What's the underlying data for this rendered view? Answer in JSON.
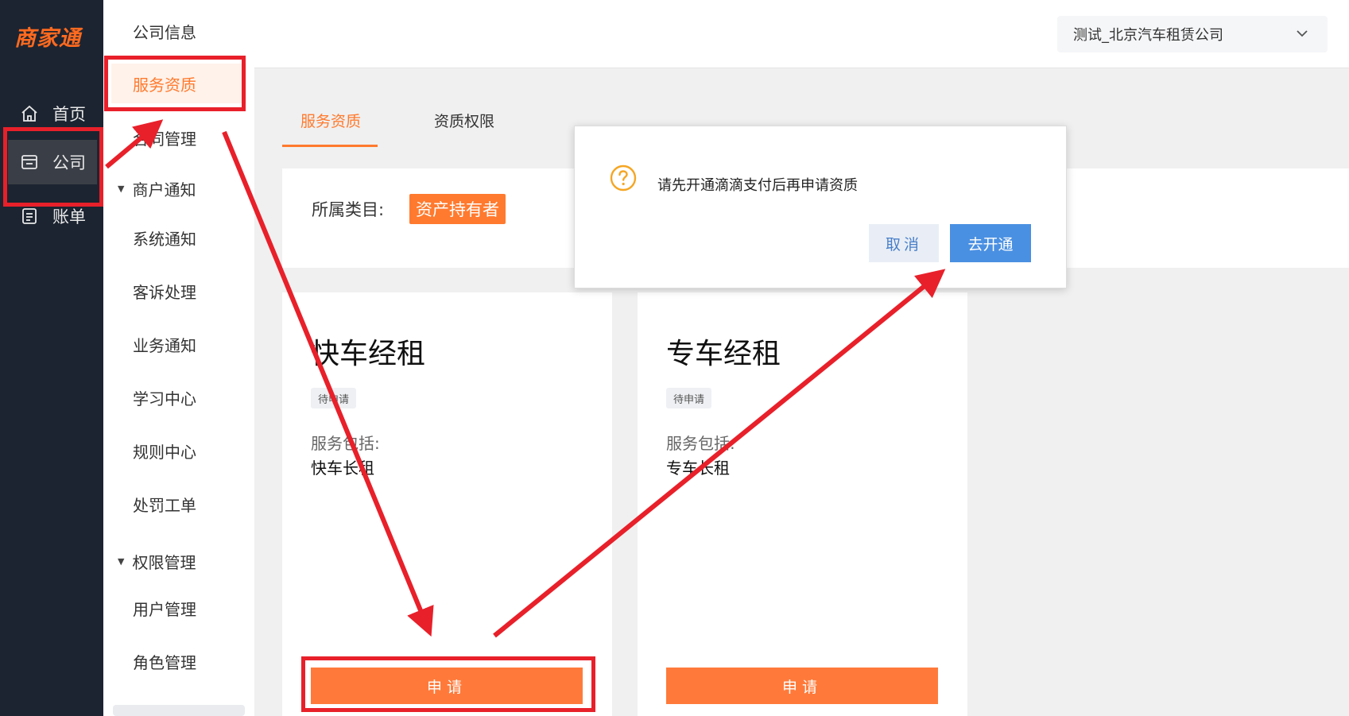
{
  "app": {
    "logo": "商家通"
  },
  "rail": {
    "items": [
      {
        "label": "首页",
        "icon": "home-icon"
      },
      {
        "label": "公司",
        "icon": "store-icon",
        "active": true
      },
      {
        "label": "账单",
        "icon": "bill-icon"
      }
    ]
  },
  "submenu": {
    "items": [
      {
        "label": "公司信息"
      },
      {
        "label": "服务资质",
        "active": true
      },
      {
        "label": "合同管理"
      }
    ],
    "groups": [
      {
        "label": "商户通知",
        "items": [
          "系统通知",
          "客诉处理",
          "业务通知",
          "学习中心",
          "规则中心",
          "处罚工单"
        ]
      },
      {
        "label": "权限管理",
        "items": [
          "用户管理",
          "角色管理"
        ]
      }
    ]
  },
  "header": {
    "company": "测试_北京汽车租赁公司"
  },
  "tabs": [
    {
      "label": "服务资质",
      "active": true
    },
    {
      "label": "资质权限"
    }
  ],
  "category": {
    "label": "所属类目:",
    "value": "资产持有者"
  },
  "cards": [
    {
      "title": "快车经租",
      "status": "待申请",
      "includes_label": "服务包括:",
      "includes_value": "快车长租",
      "button": "申请"
    },
    {
      "title": "专车经租",
      "status": "待申请",
      "includes_label": "服务包括:",
      "includes_value": "专车长租",
      "button": "申请"
    }
  ],
  "dialog": {
    "message": "请先开通滴滴支付后再申请资质",
    "cancel": "取消",
    "confirm": "去开通"
  },
  "colors": {
    "accent": "#ff7a2e",
    "primary_blue": "#4a90e2",
    "annotation_red": "#e8202a",
    "rail_bg": "#1c2431"
  }
}
